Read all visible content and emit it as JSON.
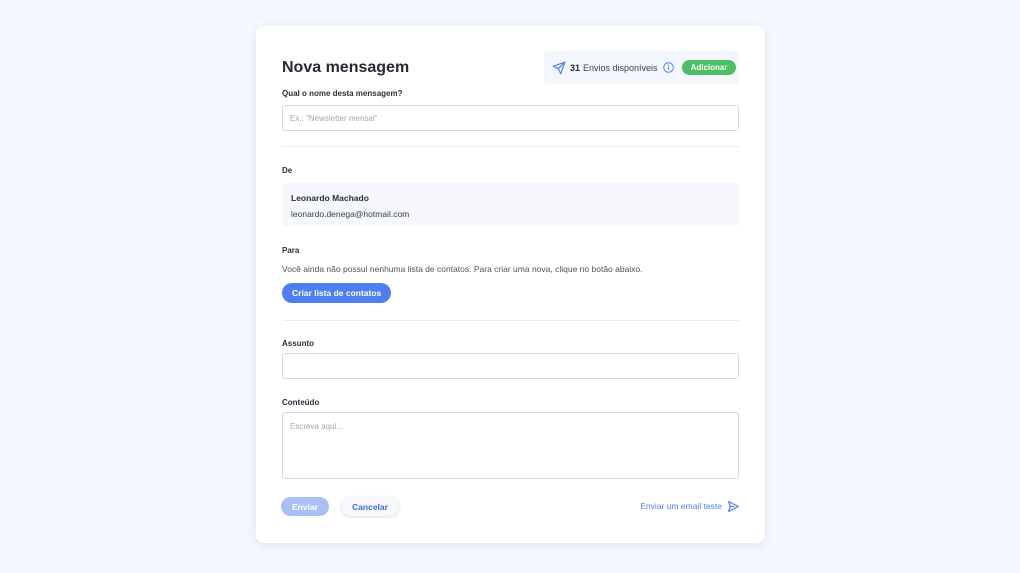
{
  "header": {
    "title": "Nova mensagem",
    "sends_count": "31",
    "sends_label": "Envios disponíveis",
    "add_button": "Adicionar",
    "icons": [
      "paper-plane-icon",
      "info-icon"
    ]
  },
  "message_name": {
    "label": "Qual o nome desta mensagem?",
    "placeholder": "Ex.: \"Newsletter mensal\"",
    "value": ""
  },
  "from": {
    "label": "De",
    "name": "Leonardo Machado",
    "email": "leonardo.denega@hotmail.com"
  },
  "to": {
    "label": "Para",
    "help_text": "Você ainda não possui nenhuma lista de contatos. Para criar uma nova, clique no botão abaixo.",
    "create_button": "Criar lista de contatos"
  },
  "subject": {
    "label": "Assunto",
    "value": ""
  },
  "content": {
    "label": "Conteúdo",
    "placeholder": "Escreva aqui..."
  },
  "footer": {
    "send_button": "Enviar",
    "cancel_button": "Cancelar",
    "test_link": "Enviar um email teste"
  },
  "colors": {
    "accent": "#4f7ef0",
    "success": "#4dbf63",
    "send_disabled": "#a9c0f6",
    "background": "#f4f8fe"
  }
}
